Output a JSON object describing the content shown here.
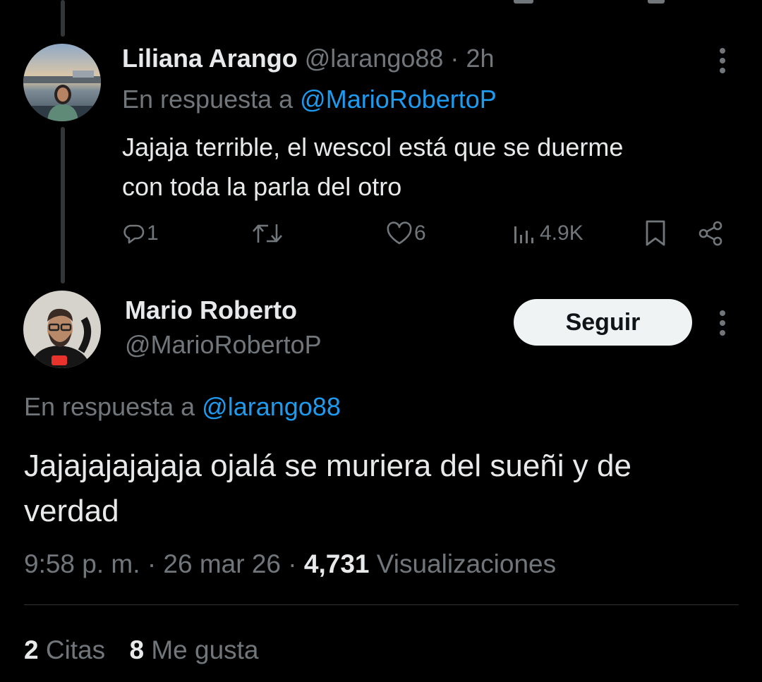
{
  "reply": {
    "author_name": "Liliana Arango",
    "handle": "@larango88",
    "separator": "·",
    "time": "2h",
    "reply_prefix": "En respuesta a",
    "reply_to": "@MarioRobertoP",
    "text_line1": "Jajaja terrible, el wescol está que se duerme",
    "text_line2": "con toda la parla del otro",
    "reply_count": "1",
    "like_count": "6",
    "view_count": "4.9K"
  },
  "main": {
    "author_name": "Mario Roberto",
    "handle": "@MarioRobertoP",
    "follow_label": "Seguir",
    "reply_prefix": "En respuesta a",
    "reply_to": "@larango88",
    "text_line1": "Jajajajajajaja ojalá se muriera del sueñi y de",
    "text_line2": "verdad",
    "time": "9:58 p. m.",
    "date": "26 mar 26",
    "sep1": "·",
    "sep2": "·",
    "views_count": "4,731",
    "views_label": "Visualizaciones",
    "quotes_count": "2",
    "quotes_label": "Citas",
    "likes_count": "8",
    "likes_label": "Me gusta"
  },
  "colors": {
    "background": "#000000",
    "text": "#e7e9ea",
    "muted": "#71767b",
    "link": "#1d9bf0",
    "follow_button": "#eff3f4"
  },
  "icons": [
    "reply-icon",
    "retweet-icon",
    "like-icon",
    "views-icon",
    "bookmark-icon",
    "share-icon",
    "more-icon"
  ]
}
